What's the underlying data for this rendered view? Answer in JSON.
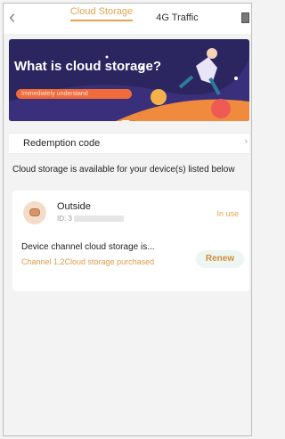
{
  "header": {
    "tabs": [
      {
        "label": "Cloud Storage",
        "active": true
      },
      {
        "label": "4G Traffic",
        "active": false
      }
    ]
  },
  "banner": {
    "title": "What is cloud storage?",
    "pill": "Immediately understand"
  },
  "redemption": {
    "label": "Redemption code"
  },
  "info_text": "Cloud storage is available for your device(s) listed below",
  "device": {
    "name": "Outside",
    "id_prefix": "ID: 3",
    "status": "In use",
    "cloud_text": "Device channel cloud storage is...",
    "channel_text": "Channel 1,2Cloud storage purchased",
    "renew_label": "Renew"
  },
  "colors": {
    "accent": "#e7a24f",
    "banner_bg": "#2b2560",
    "pill": "#ef6b3a"
  }
}
